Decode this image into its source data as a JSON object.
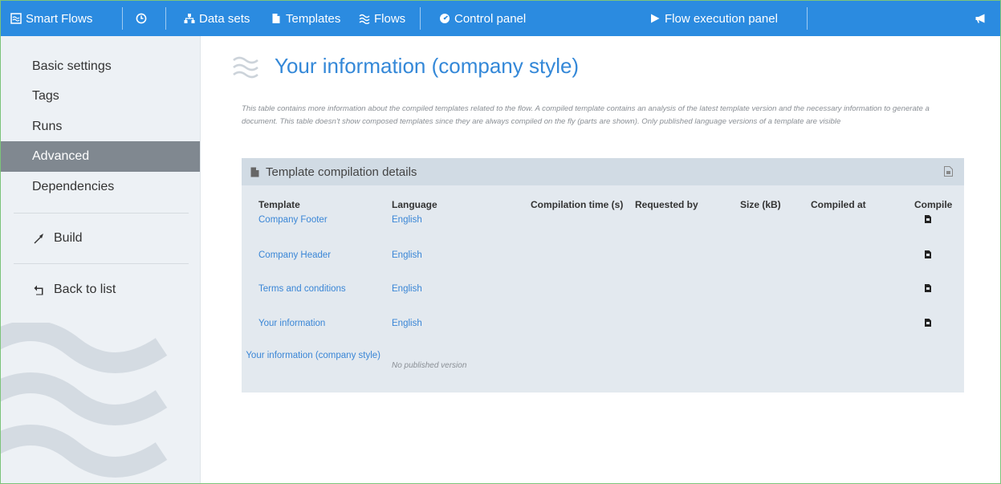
{
  "topnav": {
    "app_name": "Smart Flows",
    "data_sets": "Data sets",
    "templates": "Templates",
    "flows": "Flows",
    "control_panel": "Control panel",
    "flow_execution_panel": "Flow execution panel"
  },
  "sidebar": {
    "items": [
      {
        "label": "Basic settings"
      },
      {
        "label": "Tags"
      },
      {
        "label": "Runs"
      },
      {
        "label": "Advanced"
      },
      {
        "label": "Dependencies"
      }
    ],
    "build": "Build",
    "back": "Back to list"
  },
  "main": {
    "title": "Your information (company style)",
    "description": "This table contains more information about the compiled templates related to the flow. A compiled template contains an analysis of the latest template version and the necessary information to generate a document. This table doesn't show composed templates since they are always compiled on the fly (parts are shown). Only published language versions of a template are visible",
    "panel_title": "Template compilation details",
    "columns": [
      "Template",
      "Language",
      "Compilation time (s)",
      "Requested by",
      "Size (kB)",
      "Compiled at",
      "Compile"
    ],
    "rows": [
      {
        "template": "Company Footer",
        "language": "English"
      },
      {
        "template": "Company Header",
        "language": "English"
      },
      {
        "template": "Terms and conditions",
        "language": "English"
      },
      {
        "template": "Your information",
        "language": "English"
      },
      {
        "template": "Your information (company style)",
        "note": "No published version"
      }
    ]
  },
  "colors": {
    "nav": "#2b8be0",
    "accent": "#3488d8",
    "sidebar_bg": "#edf1f5",
    "active": "#808890",
    "panel": "#e3e9ef",
    "panel_head": "#d1dbe4"
  }
}
